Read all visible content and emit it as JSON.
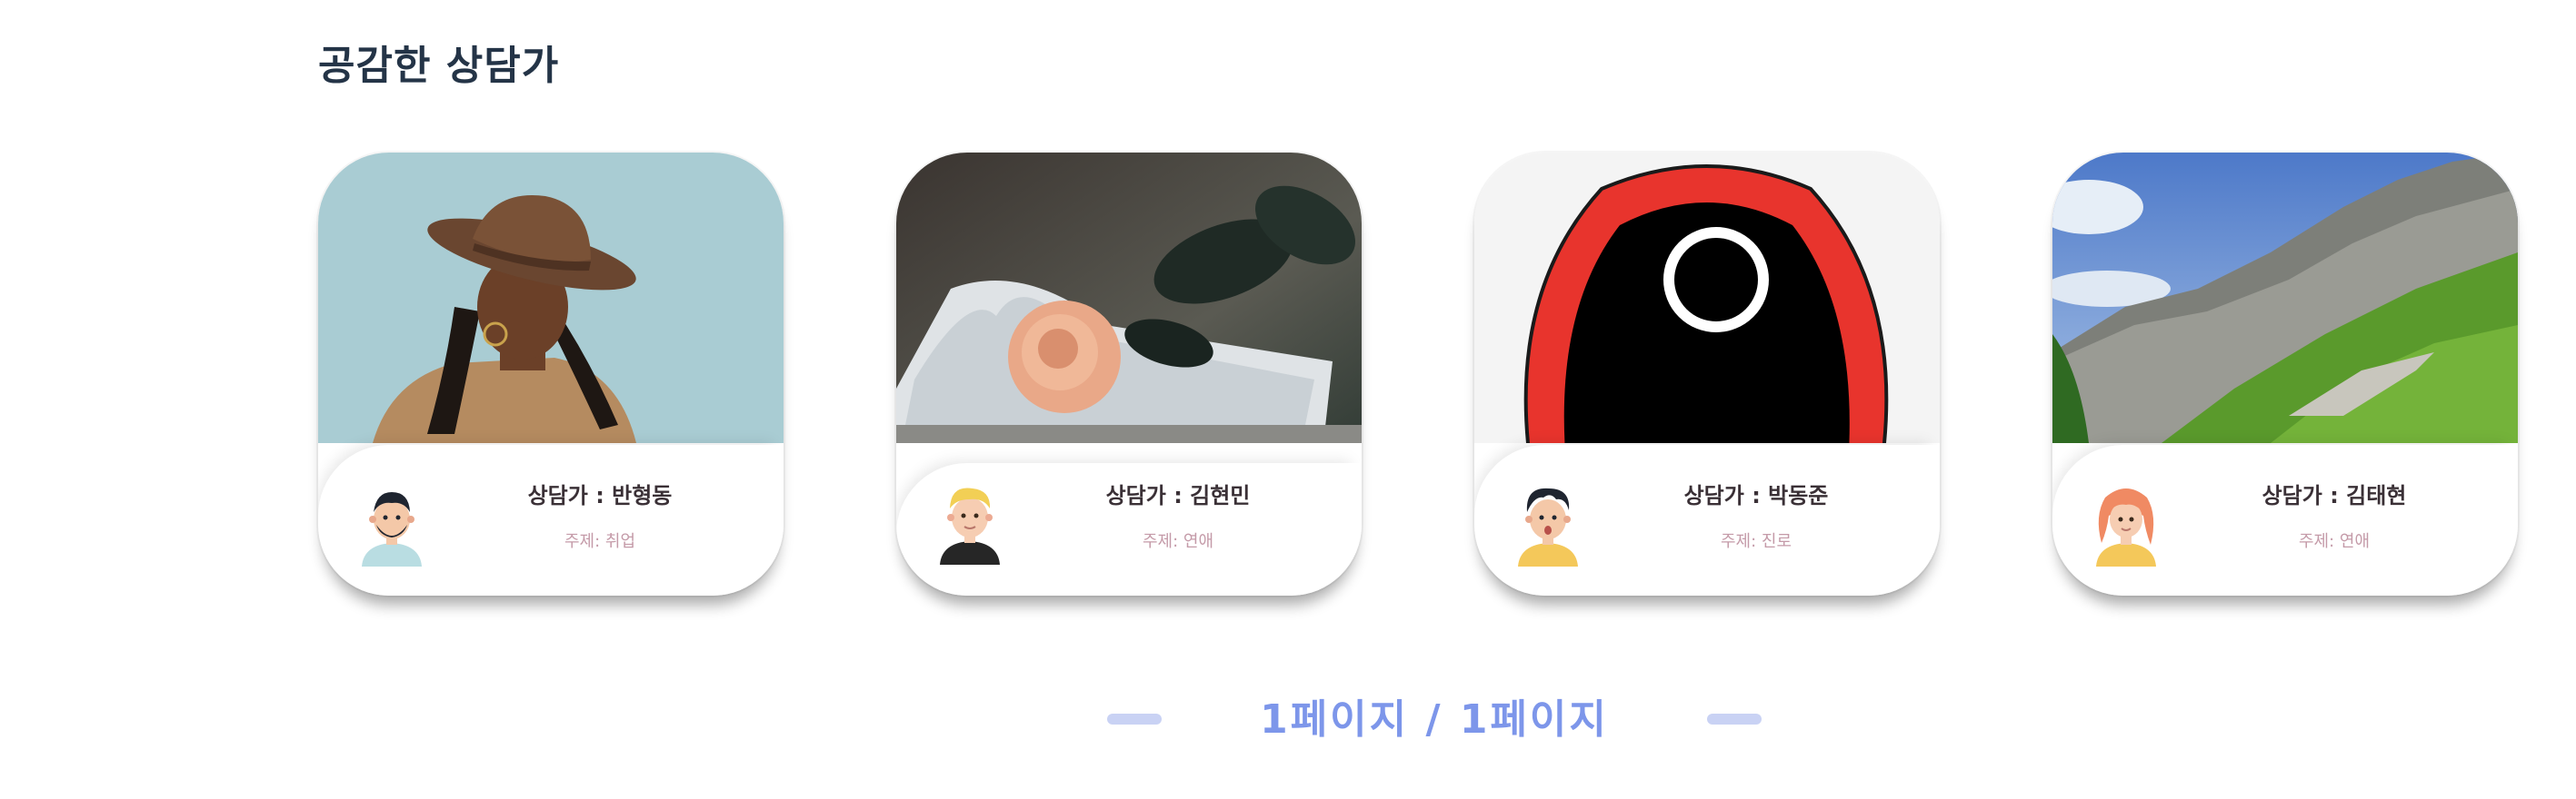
{
  "section": {
    "title": "공감한 상담가"
  },
  "cards": [
    {
      "counselor": "상담가 : 반형동",
      "topic": "주제: 취업",
      "photo": "portrait-woman-hat-photo",
      "avatar": "bearded-man-avatar-icon"
    },
    {
      "counselor": "상담가 : 김현민",
      "topic": "주제: 연애",
      "photo": "rose-on-book-photo",
      "avatar": "blonde-man-avatar-icon"
    },
    {
      "counselor": "상담가 : 박동준",
      "topic": "주제: 진로",
      "photo": "red-hood-mask-photo",
      "avatar": "surprised-boy-avatar-icon"
    },
    {
      "counselor": "상담가 : 김태현",
      "topic": "주제: 연애",
      "photo": "mountain-landscape-photo",
      "avatar": "red-haired-woman-avatar-icon"
    }
  ],
  "pagination": {
    "text": "1페이지 / 1페이지"
  },
  "colors": {
    "title": "#243447",
    "topic": "#c49aa8",
    "pagination": "#7d96ea",
    "pagination_dash": "#c9d2f4"
  }
}
